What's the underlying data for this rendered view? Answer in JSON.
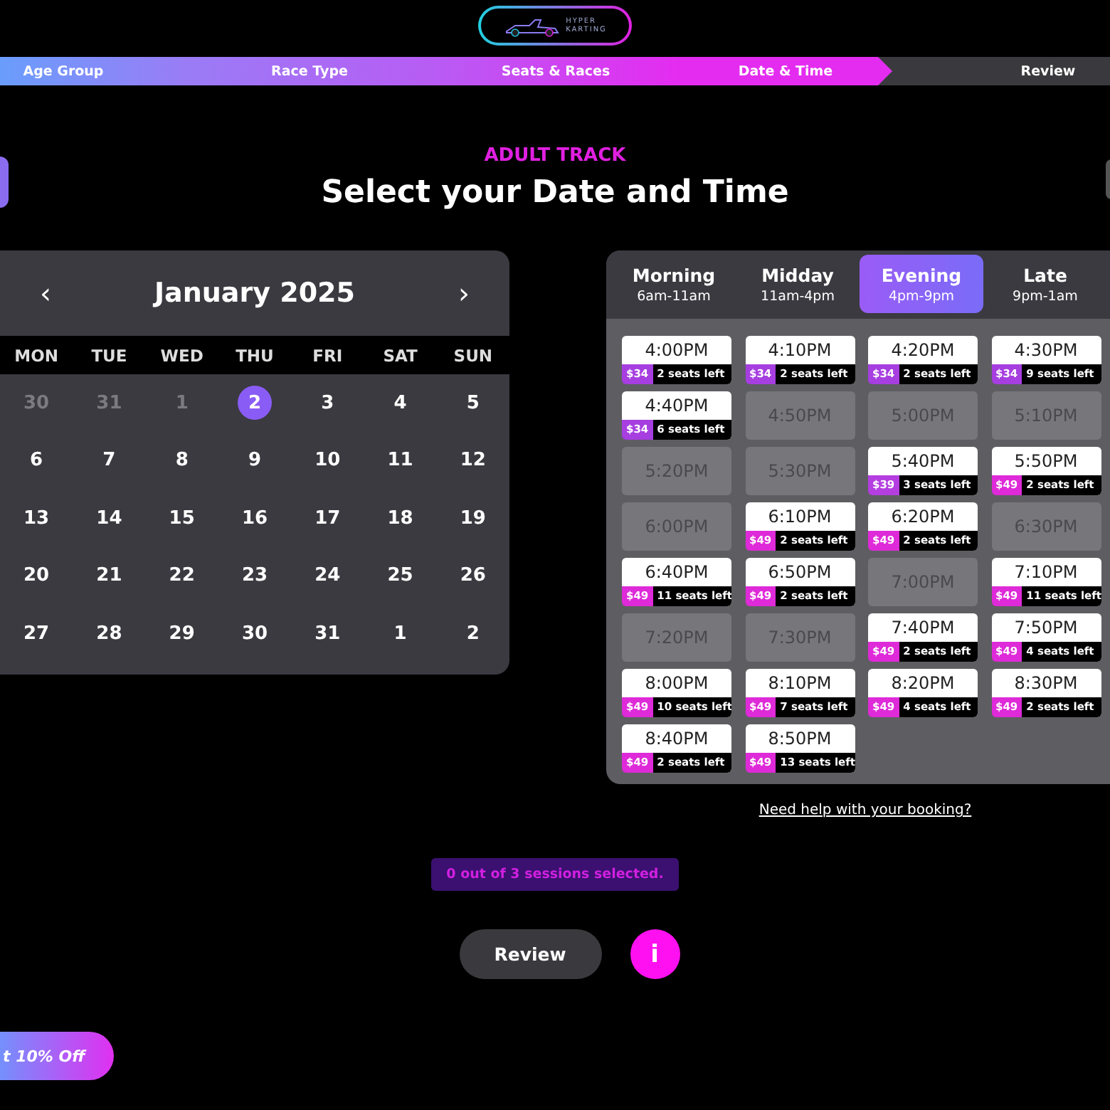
{
  "logo": {
    "line1": "HYPER",
    "line2": "KARTING"
  },
  "steps": [
    {
      "label": "Age Group",
      "done": true,
      "selected": false
    },
    {
      "label": "Race Type",
      "done": true,
      "selected": false
    },
    {
      "label": "Seats & Races",
      "done": true,
      "selected": false
    },
    {
      "label": "Date & Time",
      "done": false,
      "selected": true
    },
    {
      "label": "Review",
      "done": false,
      "selected": false
    }
  ],
  "subtitle": "ADULT TRACK",
  "title": "Select your Date and Time",
  "calendar": {
    "prev": "‹",
    "month": "January 2025",
    "next": "›",
    "weekdays": [
      "MON",
      "TUE",
      "WED",
      "THU",
      "FRI",
      "SAT",
      "SUN"
    ],
    "weeks": [
      [
        {
          "day": "30",
          "muted": true,
          "selected": false
        },
        {
          "day": "31",
          "muted": true,
          "selected": false
        },
        {
          "day": "1",
          "muted": true,
          "selected": false
        },
        {
          "day": "2",
          "muted": false,
          "selected": true
        },
        {
          "day": "3",
          "muted": false,
          "selected": false
        },
        {
          "day": "4",
          "muted": false,
          "selected": false
        },
        {
          "day": "5",
          "muted": false,
          "selected": false
        }
      ],
      [
        {
          "day": "6",
          "muted": false,
          "selected": false
        },
        {
          "day": "7",
          "muted": false,
          "selected": false
        },
        {
          "day": "8",
          "muted": false,
          "selected": false
        },
        {
          "day": "9",
          "muted": false,
          "selected": false
        },
        {
          "day": "10",
          "muted": false,
          "selected": false
        },
        {
          "day": "11",
          "muted": false,
          "selected": false
        },
        {
          "day": "12",
          "muted": false,
          "selected": false
        }
      ],
      [
        {
          "day": "13",
          "muted": false,
          "selected": false
        },
        {
          "day": "14",
          "muted": false,
          "selected": false
        },
        {
          "day": "15",
          "muted": false,
          "selected": false
        },
        {
          "day": "16",
          "muted": false,
          "selected": false
        },
        {
          "day": "17",
          "muted": false,
          "selected": false
        },
        {
          "day": "18",
          "muted": false,
          "selected": false
        },
        {
          "day": "19",
          "muted": false,
          "selected": false
        }
      ],
      [
        {
          "day": "20",
          "muted": false,
          "selected": false
        },
        {
          "day": "21",
          "muted": false,
          "selected": false
        },
        {
          "day": "22",
          "muted": false,
          "selected": false
        },
        {
          "day": "23",
          "muted": false,
          "selected": false
        },
        {
          "day": "24",
          "muted": false,
          "selected": false
        },
        {
          "day": "25",
          "muted": false,
          "selected": false
        },
        {
          "day": "26",
          "muted": false,
          "selected": false
        }
      ],
      [
        {
          "day": "27",
          "muted": false,
          "selected": false
        },
        {
          "day": "28",
          "muted": false,
          "selected": false
        },
        {
          "day": "29",
          "muted": false,
          "selected": false
        },
        {
          "day": "30",
          "muted": false,
          "selected": false
        },
        {
          "day": "31",
          "muted": false,
          "selected": false
        },
        {
          "day": "1",
          "muted": false,
          "selected": false
        },
        {
          "day": "2",
          "muted": false,
          "selected": false
        }
      ]
    ]
  },
  "periods": [
    {
      "label": "Morning",
      "range": "6am-11am",
      "selected": false
    },
    {
      "label": "Midday",
      "range": "11am-4pm",
      "selected": false
    },
    {
      "label": "Evening",
      "range": "4pm-9pm",
      "selected": true
    },
    {
      "label": "Late",
      "range": "9pm-1am",
      "selected": false
    }
  ],
  "slots": [
    {
      "kind": "available",
      "time": "4:00PM",
      "price": "$34",
      "seats": "2 seats left",
      "color": "#a63ee0"
    },
    {
      "kind": "available",
      "time": "4:10PM",
      "price": "$34",
      "seats": "2 seats left",
      "color": "#a63ee0"
    },
    {
      "kind": "available",
      "time": "4:20PM",
      "price": "$34",
      "seats": "2 seats left",
      "color": "#a63ee0"
    },
    {
      "kind": "available",
      "time": "4:30PM",
      "price": "$34",
      "seats": "9 seats left",
      "color": "#a63ee0"
    },
    {
      "kind": "available",
      "time": "4:40PM",
      "price": "$34",
      "seats": "6 seats left",
      "color": "#a63ee0"
    },
    {
      "kind": "unavailable",
      "time": "4:50PM"
    },
    {
      "kind": "unavailable",
      "time": "5:00PM"
    },
    {
      "kind": "unavailable",
      "time": "5:10PM"
    },
    {
      "kind": "unavailable",
      "time": "5:20PM"
    },
    {
      "kind": "unavailable",
      "time": "5:30PM"
    },
    {
      "kind": "available",
      "time": "5:40PM",
      "price": "$39",
      "seats": "3 seats left",
      "color": "#b43ee0"
    },
    {
      "kind": "available",
      "time": "5:50PM",
      "price": "$49",
      "seats": "2 seats left",
      "color": "#de2ad8"
    },
    {
      "kind": "unavailable",
      "time": "6:00PM"
    },
    {
      "kind": "available",
      "time": "6:10PM",
      "price": "$49",
      "seats": "2 seats left",
      "color": "#de2ad8"
    },
    {
      "kind": "available",
      "time": "6:20PM",
      "price": "$49",
      "seats": "2 seats left",
      "color": "#de2ad8"
    },
    {
      "kind": "unavailable",
      "time": "6:30PM"
    },
    {
      "kind": "available",
      "time": "6:40PM",
      "price": "$49",
      "seats": "11 seats left",
      "color": "#de2ad8"
    },
    {
      "kind": "available",
      "time": "6:50PM",
      "price": "$49",
      "seats": "2 seats left",
      "color": "#de2ad8"
    },
    {
      "kind": "unavailable",
      "time": "7:00PM"
    },
    {
      "kind": "available",
      "time": "7:10PM",
      "price": "$49",
      "seats": "11 seats left",
      "color": "#de2ad8"
    },
    {
      "kind": "unavailable",
      "time": "7:20PM"
    },
    {
      "kind": "unavailable",
      "time": "7:30PM"
    },
    {
      "kind": "available",
      "time": "7:40PM",
      "price": "$49",
      "seats": "2 seats left",
      "color": "#de2ad8"
    },
    {
      "kind": "available",
      "time": "7:50PM",
      "price": "$49",
      "seats": "4 seats left",
      "color": "#de2ad8"
    },
    {
      "kind": "available",
      "time": "8:00PM",
      "price": "$49",
      "seats": "10 seats left",
      "color": "#de2ad8"
    },
    {
      "kind": "available",
      "time": "8:10PM",
      "price": "$49",
      "seats": "7 seats left",
      "color": "#de2ad8"
    },
    {
      "kind": "available",
      "time": "8:20PM",
      "price": "$49",
      "seats": "4 seats left",
      "color": "#de2ad8"
    },
    {
      "kind": "available",
      "time": "8:30PM",
      "price": "$49",
      "seats": "2 seats left",
      "color": "#de2ad8"
    },
    {
      "kind": "available",
      "time": "8:40PM",
      "price": "$49",
      "seats": "2 seats left",
      "color": "#de2ad8"
    },
    {
      "kind": "available",
      "time": "8:50PM",
      "price": "$49",
      "seats": "13 seats left",
      "color": "#de2ad8"
    }
  ],
  "help_link": "Need help with your booking?",
  "sessions_status": "0 out of 3 sessions selected.",
  "review_button": "Review",
  "info_button": "i",
  "discount_button": "t 10% Off"
}
